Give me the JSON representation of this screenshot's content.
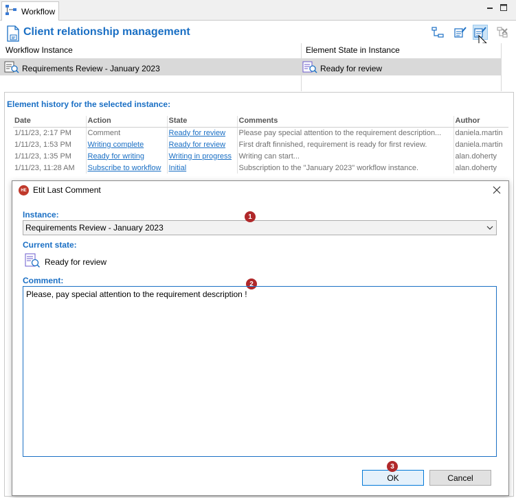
{
  "tab": {
    "label": "Workflow",
    "icon": "workflow-icon"
  },
  "header": {
    "title": "Client relationship management",
    "icon": "document-icon"
  },
  "toolbar": {
    "icons": [
      "workflow-diagram-icon",
      "edit-state-icon",
      "edit-comment-icon",
      "remove-workflow-icon"
    ]
  },
  "instances": {
    "col_instance": "Workflow Instance",
    "col_state": "Element State in Instance",
    "row": {
      "instance": "Requirements Review - January 2023",
      "state": "Ready for review"
    }
  },
  "history": {
    "title": "Element history for the selected instance:",
    "columns": [
      "Date",
      "Action",
      "State",
      "Comments",
      "Author"
    ],
    "rows": [
      {
        "date": "1/11/23, 2:17 PM",
        "action": "Comment",
        "action_link": false,
        "state": "Ready for review",
        "comment": "Please pay special attention to the requirement description...",
        "author": "daniela.martin"
      },
      {
        "date": "1/11/23, 1:53 PM",
        "action": "Writing complete",
        "action_link": true,
        "state": "Ready for review",
        "comment": "First draft finnished, requirement is ready for first review.",
        "author": "daniela.martin"
      },
      {
        "date": "1/11/23, 1:35 PM",
        "action": "Ready for writing",
        "action_link": true,
        "state": "Writing in progress",
        "comment": "Writing can start...",
        "author": "alan.doherty"
      },
      {
        "date": "1/11/23, 11:28 AM",
        "action": "Subscribe to workflow",
        "action_link": true,
        "state": "Initial",
        "comment": "Subscription to the \"January 2023\" workflow instance.",
        "author": "alan.doherty"
      }
    ]
  },
  "dialog": {
    "title": "Etit Last Comment",
    "logo_text": "HE",
    "instance_label": "Instance:",
    "instance_value": "Requirements Review - January 2023",
    "state_label": "Current state:",
    "state_value": "Ready for review",
    "comment_label": "Comment:",
    "comment_value": "Please, pay special attention to the requirement description !",
    "ok_label": "OK",
    "cancel_label": "Cancel"
  },
  "badges": [
    "1",
    "2",
    "3"
  ],
  "colors": {
    "accent": "#1a6fc4",
    "badge": "#b0282a",
    "selection": "#d9d9d9"
  }
}
